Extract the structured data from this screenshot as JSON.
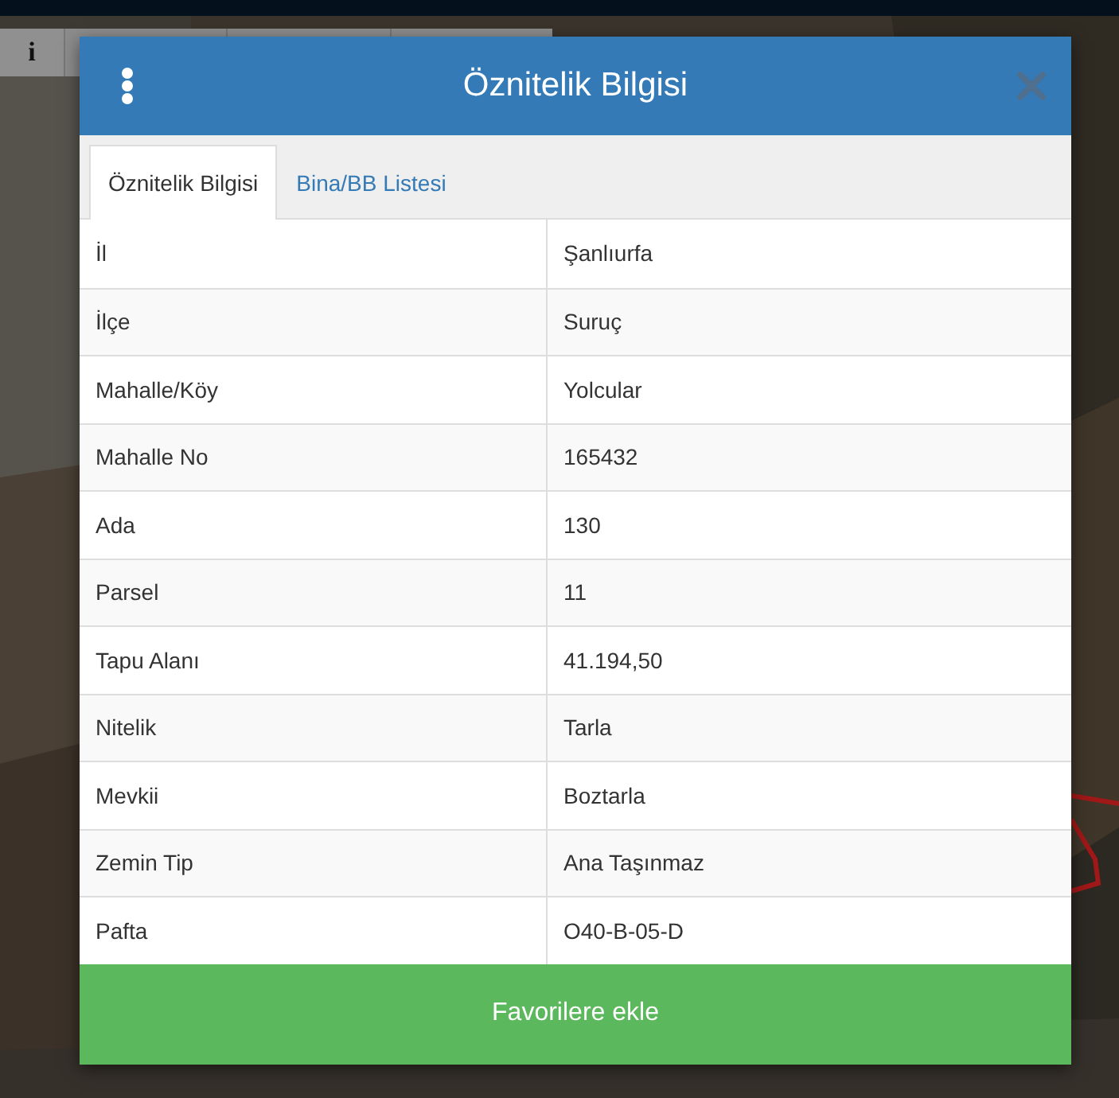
{
  "toolbar": {
    "info_button": "i"
  },
  "dialog": {
    "title": "Öznitelik Bilgisi",
    "tabs": [
      {
        "label": "Öznitelik Bilgisi",
        "selected": true
      },
      {
        "label": "Bina/BB Listesi",
        "selected": false
      }
    ],
    "rows": [
      {
        "label": "İl",
        "value": "Şanlıurfa"
      },
      {
        "label": "İlçe",
        "value": "Suruç"
      },
      {
        "label": "Mahalle/Köy",
        "value": "Yolcular"
      },
      {
        "label": "Mahalle No",
        "value": "165432"
      },
      {
        "label": "Ada",
        "value": "130"
      },
      {
        "label": "Parsel",
        "value": "11"
      },
      {
        "label": "Tapu Alanı",
        "value": "41.194,50"
      },
      {
        "label": "Nitelik",
        "value": "Tarla"
      },
      {
        "label": "Mevkii",
        "value": "Boztarla"
      },
      {
        "label": "Zemin Tip",
        "value": "Ana Taşınmaz"
      },
      {
        "label": "Pafta",
        "value": "O40-B-05-D"
      }
    ],
    "button": "Favorilere ekle"
  }
}
